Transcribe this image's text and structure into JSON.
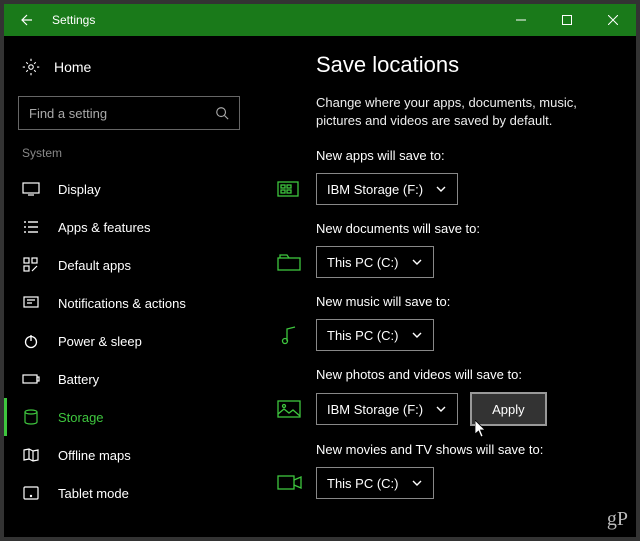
{
  "titlebar": {
    "title": "Settings"
  },
  "sidebar": {
    "home": "Home",
    "search_placeholder": "Find a setting",
    "section": "System",
    "items": [
      {
        "label": "Display"
      },
      {
        "label": "Apps & features"
      },
      {
        "label": "Default apps"
      },
      {
        "label": "Notifications & actions"
      },
      {
        "label": "Power & sleep"
      },
      {
        "label": "Battery"
      },
      {
        "label": "Storage"
      },
      {
        "label": "Offline maps"
      },
      {
        "label": "Tablet mode"
      }
    ]
  },
  "content": {
    "title": "Save locations",
    "description": "Change where your apps, documents, music, pictures and videos are saved by default.",
    "settings": [
      {
        "label": "New apps will save to:",
        "value": "IBM Storage (F:)"
      },
      {
        "label": "New documents will save to:",
        "value": "This PC (C:)"
      },
      {
        "label": "New music will save to:",
        "value": "This PC (C:)"
      },
      {
        "label": "New photos and videos will save to:",
        "value": "IBM Storage (F:)"
      },
      {
        "label": "New movies and TV shows will save to:",
        "value": "This PC (C:)"
      }
    ],
    "apply": "Apply"
  },
  "watermark": "gP"
}
